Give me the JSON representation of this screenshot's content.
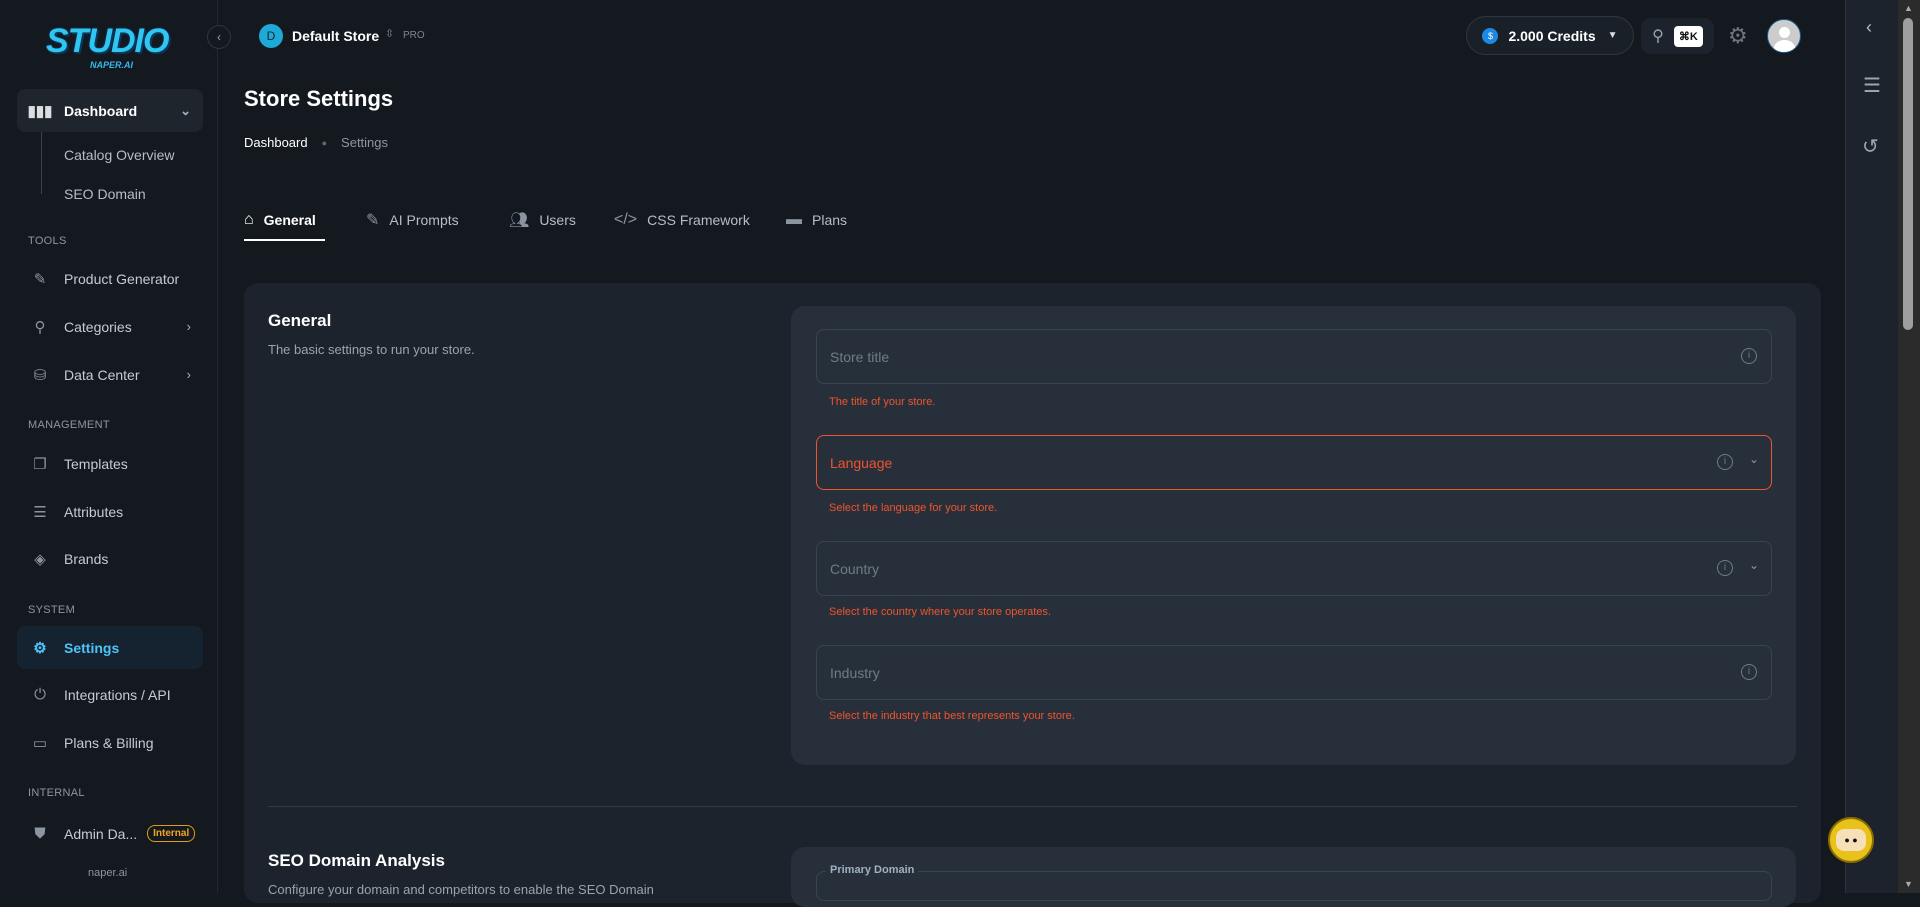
{
  "sidebar": {
    "logo": {
      "title": "STUDIO",
      "subtitle": "NAPER.AI"
    },
    "dashboard": "Dashboard",
    "sub_items": [
      "Catalog Overview",
      "SEO Domain"
    ],
    "sections": {
      "tools": "TOOLS",
      "management": "MANAGEMENT",
      "system": "SYSTEM",
      "internal": "INTERNAL"
    },
    "tools": [
      "Product Generator",
      "Categories",
      "Data Center"
    ],
    "management": [
      "Templates",
      "Attributes",
      "Brands"
    ],
    "system": [
      "Settings",
      "Integrations / API",
      "Plans & Billing"
    ],
    "internal": {
      "label": "Admin Da...",
      "badge": "Internal"
    },
    "footer": "naper.ai"
  },
  "header": {
    "store_initial": "D",
    "store_name": "Default Store",
    "plan": "PRO",
    "credits": "2.000 Credits",
    "shortcut": "⌘K"
  },
  "page": {
    "title": "Store Settings",
    "breadcrumb": [
      "Dashboard",
      "Settings"
    ]
  },
  "tabs": [
    "General",
    "AI Prompts",
    "Users",
    "CSS Framework",
    "Plans"
  ],
  "general": {
    "title": "General",
    "description": "The basic settings to run your store.",
    "fields": [
      {
        "placeholder": "Store title",
        "help": "The title of your store."
      },
      {
        "placeholder": "Language",
        "help": "Select the language for your store."
      },
      {
        "placeholder": "Country",
        "help": "Select the country where your store operates."
      },
      {
        "placeholder": "Industry",
        "help": "Select the industry that best represents your store."
      }
    ]
  },
  "seo": {
    "title": "SEO Domain Analysis",
    "description": "Configure your domain and competitors to enable the SEO Domain",
    "primary_domain_label": "Primary Domain"
  },
  "colors": {
    "accent": "#4fc3f7",
    "error": "#f0532d",
    "badge": "#f0a623"
  }
}
